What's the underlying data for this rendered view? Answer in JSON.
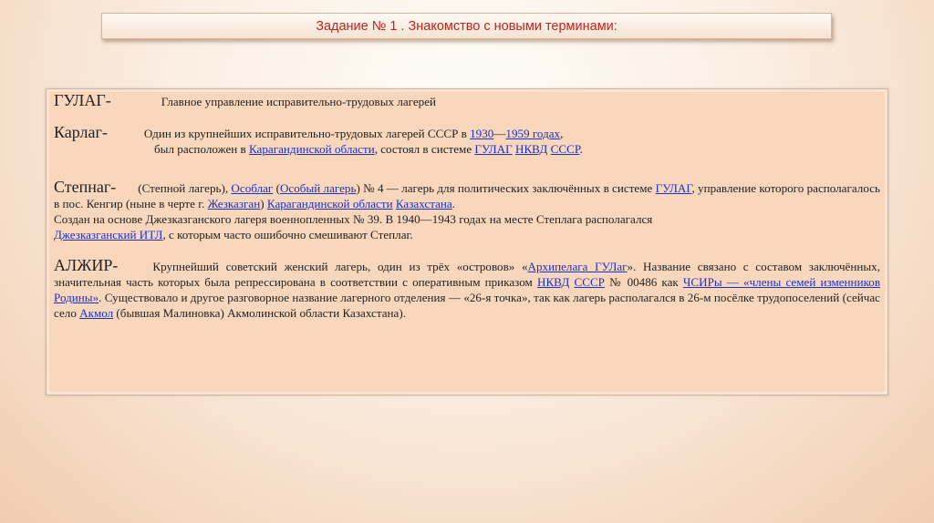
{
  "title": "Задание № 1 . Знакомство с новыми терминами:",
  "gulag": {
    "term": "ГУЛАГ-",
    "def": "Главное управление исправительно-трудовых лагерей"
  },
  "karlag": {
    "term": "Карлаг-",
    "t1": "Один из крупнейших исправительно-трудовых лагерей СССР в ",
    "l_1930": "1930",
    "dash": "—",
    "l_1959": "1959 годах",
    "t2": ",",
    "t3": "был расположен в ",
    "l_karaganda": "Карагандинской области",
    "t4": ", состоял в системе ",
    "l_gulag": "ГУЛАГ",
    "l_nkvd": "НКВД",
    "l_ussr": "СССР",
    "t5": "."
  },
  "steplag": {
    "term": "Степнаг-",
    "t1": "(Степной лагерь), ",
    "l_osoblag": "Особлаг",
    "t2": " (",
    "l_osobyi": "Особый лагерь",
    "t3": ") № 4 — лагерь для политических заключённых в системе ",
    "l_gulag": "ГУЛАГ",
    "t4": ", управление которого располагалось в пос. Кенгир (ныне в черте г. ",
    "l_zhez": "Жезказган",
    "t5": ") ",
    "l_karaganda": "Карагандинской области",
    "l_kaz": "Казахстана",
    "t6": ".",
    "line3": "Создан на основе Джезказганского лагеря военнопленных № 39. В 1940—1943 годах на месте Степлага располагался",
    "l_itl": "Джезказганский ИТЛ",
    "t7": ", с которым часто ошибочно смешивают Степлаг."
  },
  "alzhir": {
    "term": "АЛЖИР-",
    "t1": "Крупнейший советский женский лагерь, один из трёх «островов» «",
    "l_arch": "Архипелага ГУЛаг",
    "t2": "». Название связано с составом заключённых, значительная часть которых была репрессирована в соответствии с оперативным приказом ",
    "l_nkvd": "НКВД",
    "l_ussr": "СССР",
    "t3": " № 00486 как ",
    "l_chsir": "ЧСИРы — «члены семей изменников Родины»",
    "t4": ". Существовало и другое разговорное название лагерного отделения — «26-я точка», так как лагерь располагался в 26-м посёлке трудопоселений   (сейчас село ",
    "l_akmol": "Акмол",
    "t5": " (бывшая Малиновка) Акмолинской области Казахстана)."
  }
}
